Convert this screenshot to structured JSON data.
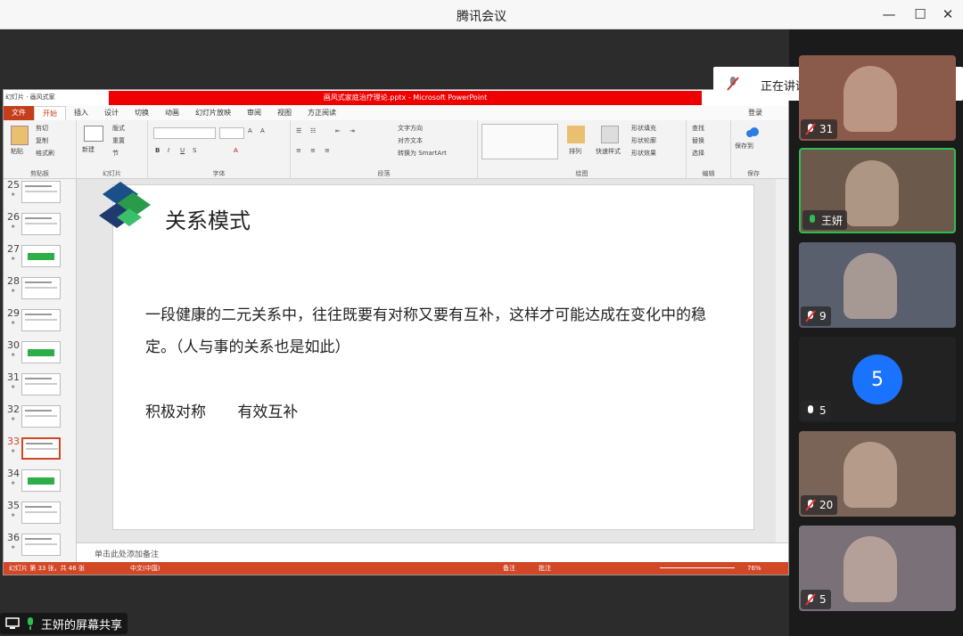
{
  "window": {
    "title": "腾讯会议",
    "min": "—",
    "max": "☐",
    "close": "✕"
  },
  "ppt": {
    "title": "画风式家庭治疗理论.pptx - Microsoft PowerPoint",
    "qat": "幻灯片 · 画风式家",
    "tabs": [
      "文件",
      "开始",
      "插入",
      "设计",
      "切换",
      "动画",
      "幻灯片放映",
      "审阅",
      "视图",
      "方正阅读"
    ],
    "login": "登录",
    "ribbon": {
      "paste": "粘贴",
      "cut": "剪切",
      "copy": "复制",
      "format_painter": "格式刷",
      "clipboard": "剪贴板",
      "new_slide": "新建\n幻灯片",
      "layout": "版式",
      "reset": "重置",
      "section": "节",
      "slides": "幻灯片",
      "font": "字体",
      "paragraph": "段落",
      "text_dir": "文字方向",
      "align_text": "对齐文本",
      "smartart": "转换为 SmartArt",
      "drawing": "绘图",
      "arrange": "排列",
      "quick_styles": "快速样式",
      "shape_fill": "形状填充",
      "shape_outline": "形状轮廓",
      "shape_effects": "形状效果",
      "find": "查找",
      "replace": "替换",
      "select": "选择",
      "editing": "编辑",
      "save_baidu": "保存到\n百度网盘",
      "save": "保存"
    },
    "thumbs": [
      {
        "num": "25",
        "type": "text"
      },
      {
        "num": "26",
        "type": "text"
      },
      {
        "num": "27",
        "type": "green"
      },
      {
        "num": "28",
        "type": "text"
      },
      {
        "num": "29",
        "type": "text"
      },
      {
        "num": "30",
        "type": "green"
      },
      {
        "num": "31",
        "type": "text"
      },
      {
        "num": "32",
        "type": "text"
      },
      {
        "num": "33",
        "type": "selected"
      },
      {
        "num": "34",
        "type": "green"
      },
      {
        "num": "35",
        "type": "text"
      },
      {
        "num": "36",
        "type": "text"
      }
    ],
    "slide": {
      "title": "关系模式",
      "body": "一段健康的二元关系中，往往既要有对称又要有互补，这样才可能达成在变化中的稳定。（人与事的关系也是如此）",
      "sub1": "积极对称",
      "sub2": "有效互补"
    },
    "notes": "单击此处添加备注",
    "status": {
      "slide_info": "幻灯片 第 33 张，共 46 张",
      "lang": "中文(中国)",
      "notes_btn": "备注",
      "comments_btn": "批注",
      "zoom": "76%"
    }
  },
  "meeting": {
    "speaking": "正在讲话: 王妍;",
    "participants": [
      {
        "label": "31",
        "name": "",
        "muted": true,
        "color": "#8a5a4a"
      },
      {
        "label": "王妍",
        "name": "王妍",
        "muted": false,
        "active": true,
        "color": "#6b5a4c"
      },
      {
        "label": "9",
        "name": "",
        "muted": true,
        "color": "#5a5f6e"
      },
      {
        "label": "5",
        "name": "",
        "muted": false,
        "avatar": "5",
        "color": "#222"
      },
      {
        "label": "20",
        "name": "",
        "muted": true,
        "color": "#7a6458"
      },
      {
        "label": "5",
        "name": "",
        "muted": true,
        "color": "#7a7078"
      }
    ],
    "share_label": "王妍的屏幕共享"
  }
}
